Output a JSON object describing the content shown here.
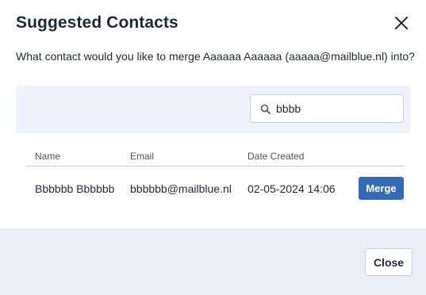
{
  "dialog": {
    "title": "Suggested Contacts",
    "prompt": "What contact would you like to merge Aaaaaa Aaaaaa (aaaaa@mailblue.nl) into?"
  },
  "search": {
    "value": "bbbb",
    "icon": "search-icon"
  },
  "table": {
    "columns": [
      "Name",
      "Email",
      "Date Created"
    ],
    "rows": [
      {
        "name": "Bbbbbb Bbbbbb",
        "email": "bbbbbb@mailblue.nl",
        "date_created": "02-05-2024 14:06",
        "action_label": "Merge"
      }
    ]
  },
  "footer": {
    "close_label": "Close"
  },
  "colors": {
    "primary": "#356ab4",
    "search_band": "#eef2fb",
    "footer_bg": "#eaeef6",
    "text": "#1f2a37"
  }
}
